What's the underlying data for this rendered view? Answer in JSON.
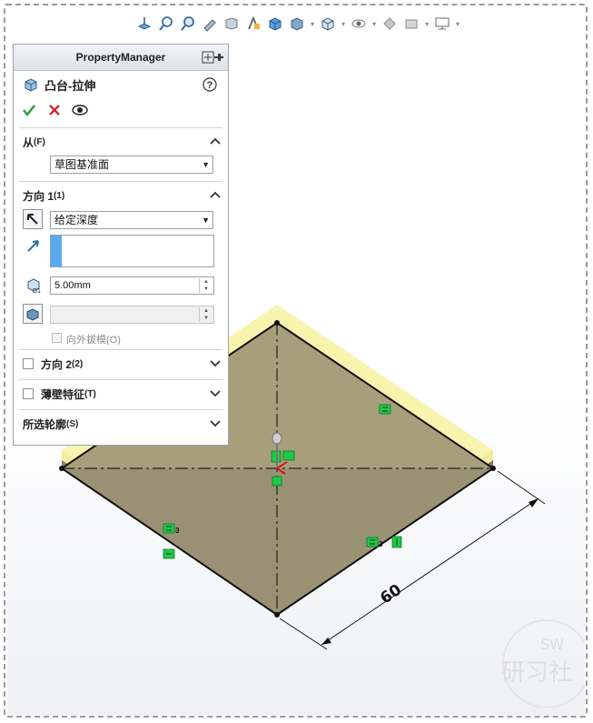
{
  "property_manager": {
    "header_title": "PropertyManager",
    "feature_title": "凸台-拉伸",
    "from_section": {
      "title": "从",
      "title_hotkey": "(F)",
      "start_condition": "草图基准面"
    },
    "direction1_section": {
      "title": "方向 1",
      "title_hotkey": "(1)",
      "end_condition": "给定深度",
      "depth_value": "5.00mm",
      "draft_angle_value": "",
      "draft_outward_label": "向外拔模(O)"
    },
    "direction2_section": {
      "title": "方向 2",
      "title_hotkey": "(2)"
    },
    "thin_feature_section": {
      "title": "薄壁特征",
      "title_hotkey": "(T)"
    },
    "selected_contours_section": {
      "title": "所选轮廓",
      "title_hotkey": "(S)"
    }
  },
  "viewport": {
    "dimension_value": "60",
    "relation_marks": [
      "3",
      "3"
    ],
    "colors": {
      "extrude_preview": "#f5f08a",
      "top_face": "#a8a07a",
      "front_face": "#8a8068",
      "relation_green": "#1ec84a"
    }
  },
  "watermark": {
    "badge": "SW",
    "text": "研习社"
  }
}
